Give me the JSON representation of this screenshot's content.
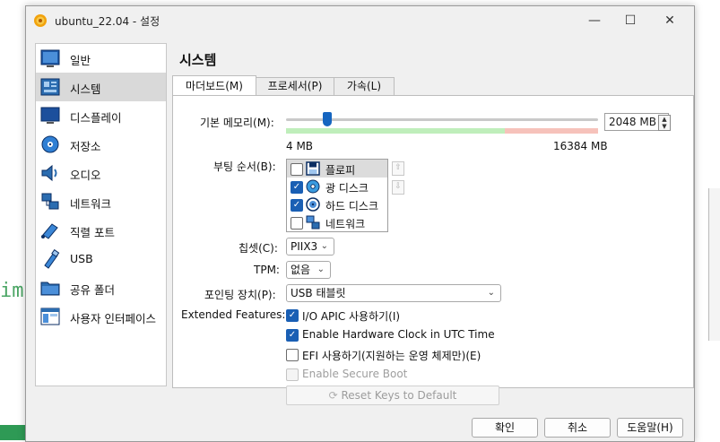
{
  "window": {
    "title": "ubuntu_22.04 - 설정"
  },
  "background": {
    "code_fragment": "im"
  },
  "sidebar": {
    "items": [
      {
        "label": "일반",
        "icon": "general-icon"
      },
      {
        "label": "시스템",
        "icon": "motherboard-icon"
      },
      {
        "label": "디스플레이",
        "icon": "display-icon"
      },
      {
        "label": "저장소",
        "icon": "storage-icon"
      },
      {
        "label": "오디오",
        "icon": "audio-icon"
      },
      {
        "label": "네트워크",
        "icon": "network-icon"
      },
      {
        "label": "직렬 포트",
        "icon": "serial-port-icon"
      },
      {
        "label": "USB",
        "icon": "usb-icon"
      },
      {
        "label": "공유 폴더",
        "icon": "shared-folder-icon"
      },
      {
        "label": "사용자 인터페이스",
        "icon": "user-interface-icon"
      }
    ],
    "selected": "시스템"
  },
  "main": {
    "title": "시스템",
    "tabs": [
      {
        "label": "마더보드(M)",
        "active": true
      },
      {
        "label": "프로세서(P)",
        "active": false
      },
      {
        "label": "가속(L)",
        "active": false
      }
    ]
  },
  "motherboard": {
    "memory_label": "기본 메모리(M):",
    "memory_value": "2048 MB",
    "memory_min": "4 MB",
    "memory_max": "16384 MB",
    "boot_order_label": "부팅 순서(B):",
    "boot_items": [
      {
        "label": "플로피",
        "checked": false,
        "icon": "floppy-icon"
      },
      {
        "label": "광 디스크",
        "checked": true,
        "icon": "optical-disc-icon"
      },
      {
        "label": "하드 디스크",
        "checked": true,
        "icon": "hard-disk-icon"
      },
      {
        "label": "네트워크",
        "checked": false,
        "icon": "network-icon"
      }
    ],
    "chipset_label": "칩셋(C):",
    "chipset_value": "PIIX3",
    "tpm_label": "TPM:",
    "tpm_value": "없음",
    "pointing_label": "포인팅 장치(P):",
    "pointing_value": "USB 태블릿",
    "extended_label": "Extended Features:",
    "features": [
      {
        "label": "I/O APIC 사용하기(I)",
        "checked": true,
        "enabled": true
      },
      {
        "label": "Enable Hardware Clock in UTC Time",
        "checked": true,
        "enabled": true
      },
      {
        "label": "EFI 사용하기(지원하는 운영 체제만)(E)",
        "checked": false,
        "enabled": true
      },
      {
        "label": "Enable Secure Boot",
        "checked": false,
        "enabled": false
      }
    ],
    "reset_keys_label": "Reset Keys to Default"
  },
  "buttons": {
    "ok": "확인",
    "cancel": "취소",
    "help": "도움말(H)"
  },
  "colors": {
    "accent": "#1a5fb4",
    "slider_thumb": "#1565c0",
    "scale_ok": "#bfeebb",
    "scale_warn": "#f6c2bb"
  }
}
